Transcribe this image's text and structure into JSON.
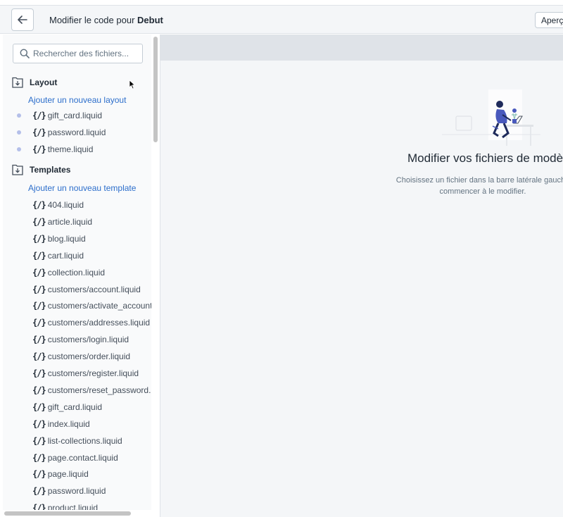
{
  "header": {
    "title_prefix": "Modifier le code pour",
    "theme_name": "Debut",
    "preview_label": "Aperçu"
  },
  "sidebar": {
    "search_placeholder": "Rechercher des fichiers...",
    "layout": {
      "label": "Layout",
      "add_label": "Ajouter un nouveau layout",
      "files": [
        "gift_card.liquid",
        "password.liquid",
        "theme.liquid"
      ]
    },
    "templates": {
      "label": "Templates",
      "add_label": "Ajouter un nouveau template",
      "files": [
        "404.liquid",
        "article.liquid",
        "blog.liquid",
        "cart.liquid",
        "collection.liquid",
        "customers/account.liquid",
        "customers/activate_account.",
        "customers/addresses.liquid",
        "customers/login.liquid",
        "customers/order.liquid",
        "customers/register.liquid",
        "customers/reset_password.li",
        "gift_card.liquid",
        "index.liquid",
        "list-collections.liquid",
        "page.contact.liquid",
        "page.liquid",
        "password.liquid",
        "product.liquid"
      ]
    },
    "curly_glyph": "{/}"
  },
  "main": {
    "empty_title": "Modifier vos fichiers de modèle",
    "empty_desc_line1": "Choisissez un fichier dans la barre latérale gauche",
    "empty_desc_line2": "commencer à le modifier."
  },
  "colors": {
    "link": "#2c6ecb",
    "dot": "#b4bfe9",
    "illustration_accent": "#4959bd"
  }
}
